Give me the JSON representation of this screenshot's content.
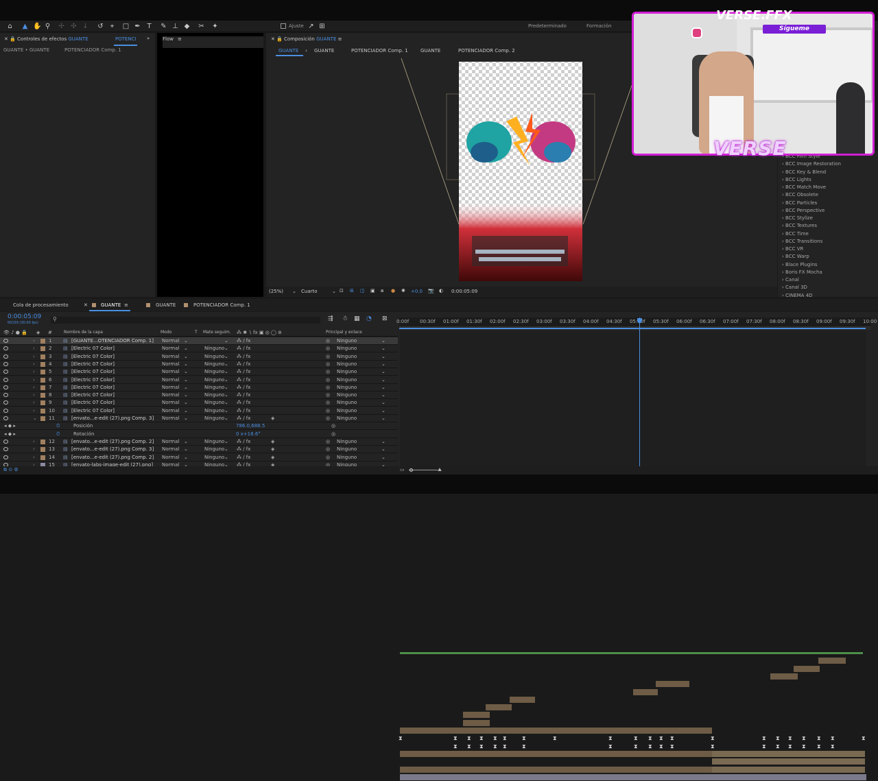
{
  "workspace": {
    "default": "Predeterminado",
    "training": "Formación",
    "ajuste": "Ajuste"
  },
  "left_panel": {
    "tab": "Controles de efectos",
    "tab_highlight": "GUANTE",
    "tab2": "POTENCI",
    "breadcrumb1": "GUANTE • GUANTE",
    "breadcrumb2": "POTENCIADOR Comp. 1"
  },
  "flow_panel": {
    "title": "Flow"
  },
  "comp_panel": {
    "label": "Composición",
    "name": "GUANTE",
    "subtabs": [
      "GUANTE",
      "GUANTE",
      "POTENCIADOR Comp. 1",
      "GUANTE",
      "POTENCIADOR Comp. 2"
    ],
    "zoom": "(25%)",
    "quality": "Cuarto",
    "exposure": "+0.0",
    "timecode": "0:00:05:09"
  },
  "bottom_tabs": [
    "Cola de procesamiento",
    "GUANTE",
    "GUANTE",
    "POTENCIADOR Comp. 1"
  ],
  "timeline": {
    "timecode": "0:00:05:09",
    "frames": "00159 (30.00 fps)",
    "headers": {
      "name": "Nombre de la capa",
      "mode": "Modo",
      "t": "T",
      "matte": "Mate seguim.",
      "parent": "Principal y enlace"
    },
    "ruler": [
      "0:00f",
      "00:30f",
      "01:00f",
      "01:30f",
      "02:00f",
      "02:30f",
      "03:00f",
      "03:30f",
      "04:00f",
      "04:30f",
      "05:00f",
      "05:30f",
      "06:00f",
      "06:30f",
      "07:00f",
      "07:30f",
      "08:00f",
      "08:30f",
      "09:00f",
      "09:30f",
      "10:00"
    ],
    "layers": [
      {
        "num": "1",
        "name": "[GUANTE...OTENCIADOR Comp. 1]",
        "mode": "Normal",
        "matte": "",
        "parent": "Ninguno",
        "color": "#a08060"
      },
      {
        "num": "2",
        "name": "[Electric 07 Color]",
        "mode": "Normal",
        "matte": "Ninguno",
        "parent": "Ninguno",
        "color": "#a08060"
      },
      {
        "num": "3",
        "name": "[Electric 07 Color]",
        "mode": "Normal",
        "matte": "Ninguno",
        "parent": "Ninguno",
        "color": "#a08060"
      },
      {
        "num": "4",
        "name": "[Electric 07 Color]",
        "mode": "Normal",
        "matte": "Ninguno",
        "parent": "Ninguno",
        "color": "#a08060"
      },
      {
        "num": "5",
        "name": "[Electric 07 Color]",
        "mode": "Normal",
        "matte": "Ninguno",
        "parent": "Ninguno",
        "color": "#a08060"
      },
      {
        "num": "6",
        "name": "[Electric 07 Color]",
        "mode": "Normal",
        "matte": "Ninguno",
        "parent": "Ninguno",
        "color": "#a08060"
      },
      {
        "num": "7",
        "name": "[Electric 07 Color]",
        "mode": "Normal",
        "matte": "Ninguno",
        "parent": "Ninguno",
        "color": "#a08060"
      },
      {
        "num": "8",
        "name": "[Electric 07 Color]",
        "mode": "Normal",
        "matte": "Ninguno",
        "parent": "Ninguno",
        "color": "#a08060"
      },
      {
        "num": "9",
        "name": "[Electric 07 Color]",
        "mode": "Normal",
        "matte": "Ninguno",
        "parent": "Ninguno",
        "color": "#a08060"
      },
      {
        "num": "10",
        "name": "[Electric 07 Color]",
        "mode": "Normal",
        "matte": "Ninguno",
        "parent": "Ninguno",
        "color": "#a08060"
      },
      {
        "num": "11",
        "name": "[envato...e-edit (27).png Comp. 3]",
        "mode": "Normal",
        "matte": "Ninguno",
        "parent": "Ninguno",
        "color": "#a08060"
      },
      {
        "num": "12",
        "name": "[envato...e-edit (27).png Comp. 2]",
        "mode": "Normal",
        "matte": "Ninguno",
        "parent": "Ninguno",
        "color": "#a08060"
      },
      {
        "num": "13",
        "name": "[envato...e-edit (27).png Comp. 3]",
        "mode": "Normal",
        "matte": "Ninguno",
        "parent": "Ninguno",
        "color": "#a08060"
      },
      {
        "num": "14",
        "name": "[envato...e-edit (27).png Comp. 2]",
        "mode": "Normal",
        "matte": "Ninguno",
        "parent": "Ninguno",
        "color": "#a08060"
      },
      {
        "num": "15",
        "name": "[envato-labs-image-edit (27).png]",
        "mode": "Normal",
        "matte": "Ninguno",
        "parent": "Ninguno",
        "color": "#8a8aa0"
      }
    ],
    "props": [
      {
        "name": "Posición",
        "value": "786.0,688.5"
      },
      {
        "name": "Rotación",
        "value": "0 x+18.6°"
      }
    ]
  },
  "effects": [
    "BCC Film Style",
    "BCC Image Restoration",
    "BCC Key & Blend",
    "BCC Lights",
    "BCC Match Move",
    "BCC Obsolete",
    "BCC Particles",
    "BCC Perspective",
    "BCC Stylize",
    "BCC Textures",
    "BCC Time",
    "BCC Transitions",
    "BCC VR",
    "BCC Warp",
    "Blace Plugins",
    "Boris FX Mocha",
    "Canal",
    "Canal 3D",
    "CINEMA 4D"
  ],
  "overlay": {
    "brand": "VERSE.FFX",
    "follow": "Sígueme",
    "logo": "VERSE"
  },
  "colors": {
    "accent": "#4b8fe2",
    "magenta": "#d21fd6",
    "playhead": "#4b8fe2"
  }
}
